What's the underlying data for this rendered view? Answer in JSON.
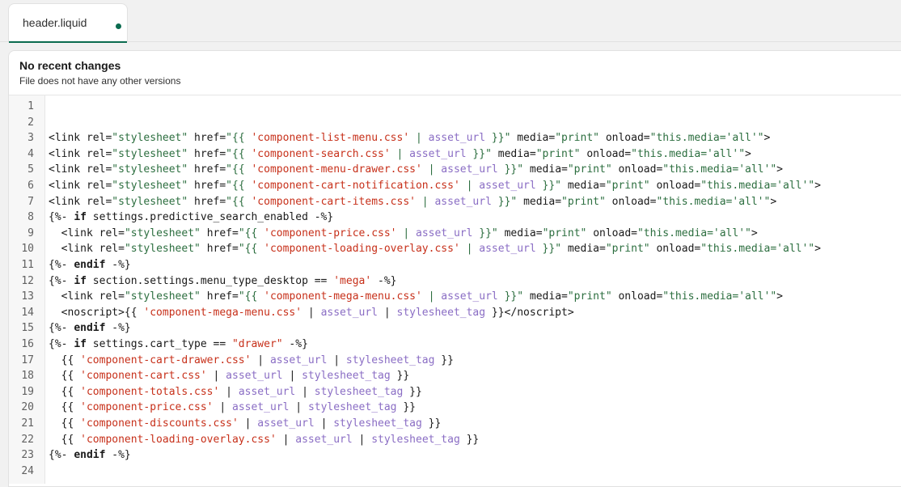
{
  "tab": {
    "label": "header.liquid",
    "modified_indicator_color": "#0b6b4f"
  },
  "history": {
    "title": "No recent changes",
    "subtitle": "File does not have any other versions"
  },
  "editor": {
    "lines": [
      {
        "n": "1",
        "tokens": []
      },
      {
        "n": "2",
        "tokens": []
      },
      {
        "n": "3",
        "tokens": [
          [
            "t",
            "<link "
          ],
          [
            "a",
            "rel="
          ],
          [
            "s",
            "\"stylesheet\""
          ],
          [
            "t",
            " "
          ],
          [
            "a",
            "href="
          ],
          [
            "s",
            "\"{{ "
          ],
          [
            "l",
            "'component-list-menu.css'"
          ],
          [
            "s",
            " | "
          ],
          [
            "f",
            "asset_url"
          ],
          [
            "s",
            " }}\""
          ],
          [
            "t",
            " "
          ],
          [
            "a",
            "media="
          ],
          [
            "s",
            "\"print\""
          ],
          [
            "t",
            " "
          ],
          [
            "a",
            "onload="
          ],
          [
            "s",
            "\"this.media='all'\""
          ],
          [
            "t",
            ">"
          ]
        ]
      },
      {
        "n": "4",
        "tokens": [
          [
            "t",
            "<link "
          ],
          [
            "a",
            "rel="
          ],
          [
            "s",
            "\"stylesheet\""
          ],
          [
            "t",
            " "
          ],
          [
            "a",
            "href="
          ],
          [
            "s",
            "\"{{ "
          ],
          [
            "l",
            "'component-search.css'"
          ],
          [
            "s",
            " | "
          ],
          [
            "f",
            "asset_url"
          ],
          [
            "s",
            " }}\""
          ],
          [
            "t",
            " "
          ],
          [
            "a",
            "media="
          ],
          [
            "s",
            "\"print\""
          ],
          [
            "t",
            " "
          ],
          [
            "a",
            "onload="
          ],
          [
            "s",
            "\"this.media='all'\""
          ],
          [
            "t",
            ">"
          ]
        ]
      },
      {
        "n": "5",
        "tokens": [
          [
            "t",
            "<link "
          ],
          [
            "a",
            "rel="
          ],
          [
            "s",
            "\"stylesheet\""
          ],
          [
            "t",
            " "
          ],
          [
            "a",
            "href="
          ],
          [
            "s",
            "\"{{ "
          ],
          [
            "l",
            "'component-menu-drawer.css'"
          ],
          [
            "s",
            " | "
          ],
          [
            "f",
            "asset_url"
          ],
          [
            "s",
            " }}\""
          ],
          [
            "t",
            " "
          ],
          [
            "a",
            "media="
          ],
          [
            "s",
            "\"print\""
          ],
          [
            "t",
            " "
          ],
          [
            "a",
            "onload="
          ],
          [
            "s",
            "\"this.media='all'\""
          ],
          [
            "t",
            ">"
          ]
        ]
      },
      {
        "n": "6",
        "tokens": [
          [
            "t",
            "<link "
          ],
          [
            "a",
            "rel="
          ],
          [
            "s",
            "\"stylesheet\""
          ],
          [
            "t",
            " "
          ],
          [
            "a",
            "href="
          ],
          [
            "s",
            "\"{{ "
          ],
          [
            "l",
            "'component-cart-notification.css'"
          ],
          [
            "s",
            " | "
          ],
          [
            "f",
            "asset_url"
          ],
          [
            "s",
            " }}\""
          ],
          [
            "t",
            " "
          ],
          [
            "a",
            "media="
          ],
          [
            "s",
            "\"print\""
          ],
          [
            "t",
            " "
          ],
          [
            "a",
            "onload="
          ],
          [
            "s",
            "\"this.media='all'\""
          ],
          [
            "t",
            ">"
          ]
        ]
      },
      {
        "n": "7",
        "tokens": [
          [
            "t",
            "<link "
          ],
          [
            "a",
            "rel="
          ],
          [
            "s",
            "\"stylesheet\""
          ],
          [
            "t",
            " "
          ],
          [
            "a",
            "href="
          ],
          [
            "s",
            "\"{{ "
          ],
          [
            "l",
            "'component-cart-items.css'"
          ],
          [
            "s",
            " | "
          ],
          [
            "f",
            "asset_url"
          ],
          [
            "s",
            " }}\""
          ],
          [
            "t",
            " "
          ],
          [
            "a",
            "media="
          ],
          [
            "s",
            "\"print\""
          ],
          [
            "t",
            " "
          ],
          [
            "a",
            "onload="
          ],
          [
            "s",
            "\"this.media='all'\""
          ],
          [
            "t",
            ">"
          ]
        ]
      },
      {
        "n": "8",
        "tokens": [
          [
            "t",
            "{%- "
          ],
          [
            "k",
            "if"
          ],
          [
            "t",
            " settings.predictive_search_enabled -%}"
          ]
        ]
      },
      {
        "n": "9",
        "tokens": [
          [
            "t",
            "  <link "
          ],
          [
            "a",
            "rel="
          ],
          [
            "s",
            "\"stylesheet\""
          ],
          [
            "t",
            " "
          ],
          [
            "a",
            "href="
          ],
          [
            "s",
            "\"{{ "
          ],
          [
            "l",
            "'component-price.css'"
          ],
          [
            "s",
            " | "
          ],
          [
            "f",
            "asset_url"
          ],
          [
            "s",
            " }}\""
          ],
          [
            "t",
            " "
          ],
          [
            "a",
            "media="
          ],
          [
            "s",
            "\"print\""
          ],
          [
            "t",
            " "
          ],
          [
            "a",
            "onload="
          ],
          [
            "s",
            "\"this.media='all'\""
          ],
          [
            "t",
            ">"
          ]
        ]
      },
      {
        "n": "10",
        "tokens": [
          [
            "t",
            "  <link "
          ],
          [
            "a",
            "rel="
          ],
          [
            "s",
            "\"stylesheet\""
          ],
          [
            "t",
            " "
          ],
          [
            "a",
            "href="
          ],
          [
            "s",
            "\"{{ "
          ],
          [
            "l",
            "'component-loading-overlay.css'"
          ],
          [
            "s",
            " | "
          ],
          [
            "f",
            "asset_url"
          ],
          [
            "s",
            " }}\""
          ],
          [
            "t",
            " "
          ],
          [
            "a",
            "media="
          ],
          [
            "s",
            "\"print\""
          ],
          [
            "t",
            " "
          ],
          [
            "a",
            "onload="
          ],
          [
            "s",
            "\"this.media='all'\""
          ],
          [
            "t",
            ">"
          ]
        ]
      },
      {
        "n": "11",
        "tokens": [
          [
            "t",
            "{%- "
          ],
          [
            "k",
            "endif"
          ],
          [
            "t",
            " -%}"
          ]
        ]
      },
      {
        "n": "12",
        "tokens": [
          [
            "t",
            "{%- "
          ],
          [
            "k",
            "if"
          ],
          [
            "t",
            " section.settings.menu_type_desktop == "
          ],
          [
            "l",
            "'mega'"
          ],
          [
            "t",
            " -%}"
          ]
        ]
      },
      {
        "n": "13",
        "tokens": [
          [
            "t",
            "  <link "
          ],
          [
            "a",
            "rel="
          ],
          [
            "s",
            "\"stylesheet\""
          ],
          [
            "t",
            " "
          ],
          [
            "a",
            "href="
          ],
          [
            "s",
            "\"{{ "
          ],
          [
            "l",
            "'component-mega-menu.css'"
          ],
          [
            "s",
            " | "
          ],
          [
            "f",
            "asset_url"
          ],
          [
            "s",
            " }}\""
          ],
          [
            "t",
            " "
          ],
          [
            "a",
            "media="
          ],
          [
            "s",
            "\"print\""
          ],
          [
            "t",
            " "
          ],
          [
            "a",
            "onload="
          ],
          [
            "s",
            "\"this.media='all'\""
          ],
          [
            "t",
            ">"
          ]
        ]
      },
      {
        "n": "14",
        "tokens": [
          [
            "t",
            "  <noscript>{{ "
          ],
          [
            "l",
            "'component-mega-menu.css'"
          ],
          [
            "t",
            " | "
          ],
          [
            "f",
            "asset_url"
          ],
          [
            "t",
            " | "
          ],
          [
            "f",
            "stylesheet_tag"
          ],
          [
            "t",
            " }}</noscript>"
          ]
        ]
      },
      {
        "n": "15",
        "tokens": [
          [
            "t",
            "{%- "
          ],
          [
            "k",
            "endif"
          ],
          [
            "t",
            " -%}"
          ]
        ]
      },
      {
        "n": "16",
        "tokens": [
          [
            "t",
            "{%- "
          ],
          [
            "k",
            "if"
          ],
          [
            "t",
            " settings.cart_type == "
          ],
          [
            "l",
            "\"drawer\""
          ],
          [
            "t",
            " -%}"
          ]
        ]
      },
      {
        "n": "17",
        "tokens": [
          [
            "t",
            "  {{ "
          ],
          [
            "l",
            "'component-cart-drawer.css'"
          ],
          [
            "t",
            " | "
          ],
          [
            "f",
            "asset_url"
          ],
          [
            "t",
            " | "
          ],
          [
            "f",
            "stylesheet_tag"
          ],
          [
            "t",
            " }}"
          ]
        ]
      },
      {
        "n": "18",
        "tokens": [
          [
            "t",
            "  {{ "
          ],
          [
            "l",
            "'component-cart.css'"
          ],
          [
            "t",
            " | "
          ],
          [
            "f",
            "asset_url"
          ],
          [
            "t",
            " | "
          ],
          [
            "f",
            "stylesheet_tag"
          ],
          [
            "t",
            " }}"
          ]
        ]
      },
      {
        "n": "19",
        "tokens": [
          [
            "t",
            "  {{ "
          ],
          [
            "l",
            "'component-totals.css'"
          ],
          [
            "t",
            " | "
          ],
          [
            "f",
            "asset_url"
          ],
          [
            "t",
            " | "
          ],
          [
            "f",
            "stylesheet_tag"
          ],
          [
            "t",
            " }}"
          ]
        ]
      },
      {
        "n": "20",
        "tokens": [
          [
            "t",
            "  {{ "
          ],
          [
            "l",
            "'component-price.css'"
          ],
          [
            "t",
            " | "
          ],
          [
            "f",
            "asset_url"
          ],
          [
            "t",
            " | "
          ],
          [
            "f",
            "stylesheet_tag"
          ],
          [
            "t",
            " }}"
          ]
        ]
      },
      {
        "n": "21",
        "tokens": [
          [
            "t",
            "  {{ "
          ],
          [
            "l",
            "'component-discounts.css'"
          ],
          [
            "t",
            " | "
          ],
          [
            "f",
            "asset_url"
          ],
          [
            "t",
            " | "
          ],
          [
            "f",
            "stylesheet_tag"
          ],
          [
            "t",
            " }}"
          ]
        ]
      },
      {
        "n": "22",
        "tokens": [
          [
            "t",
            "  {{ "
          ],
          [
            "l",
            "'component-loading-overlay.css'"
          ],
          [
            "t",
            " | "
          ],
          [
            "f",
            "asset_url"
          ],
          [
            "t",
            " | "
          ],
          [
            "f",
            "stylesheet_tag"
          ],
          [
            "t",
            " }}"
          ]
        ]
      },
      {
        "n": "23",
        "tokens": [
          [
            "t",
            "{%- "
          ],
          [
            "k",
            "endif"
          ],
          [
            "t",
            " -%}"
          ]
        ]
      },
      {
        "n": "24",
        "tokens": []
      }
    ]
  }
}
